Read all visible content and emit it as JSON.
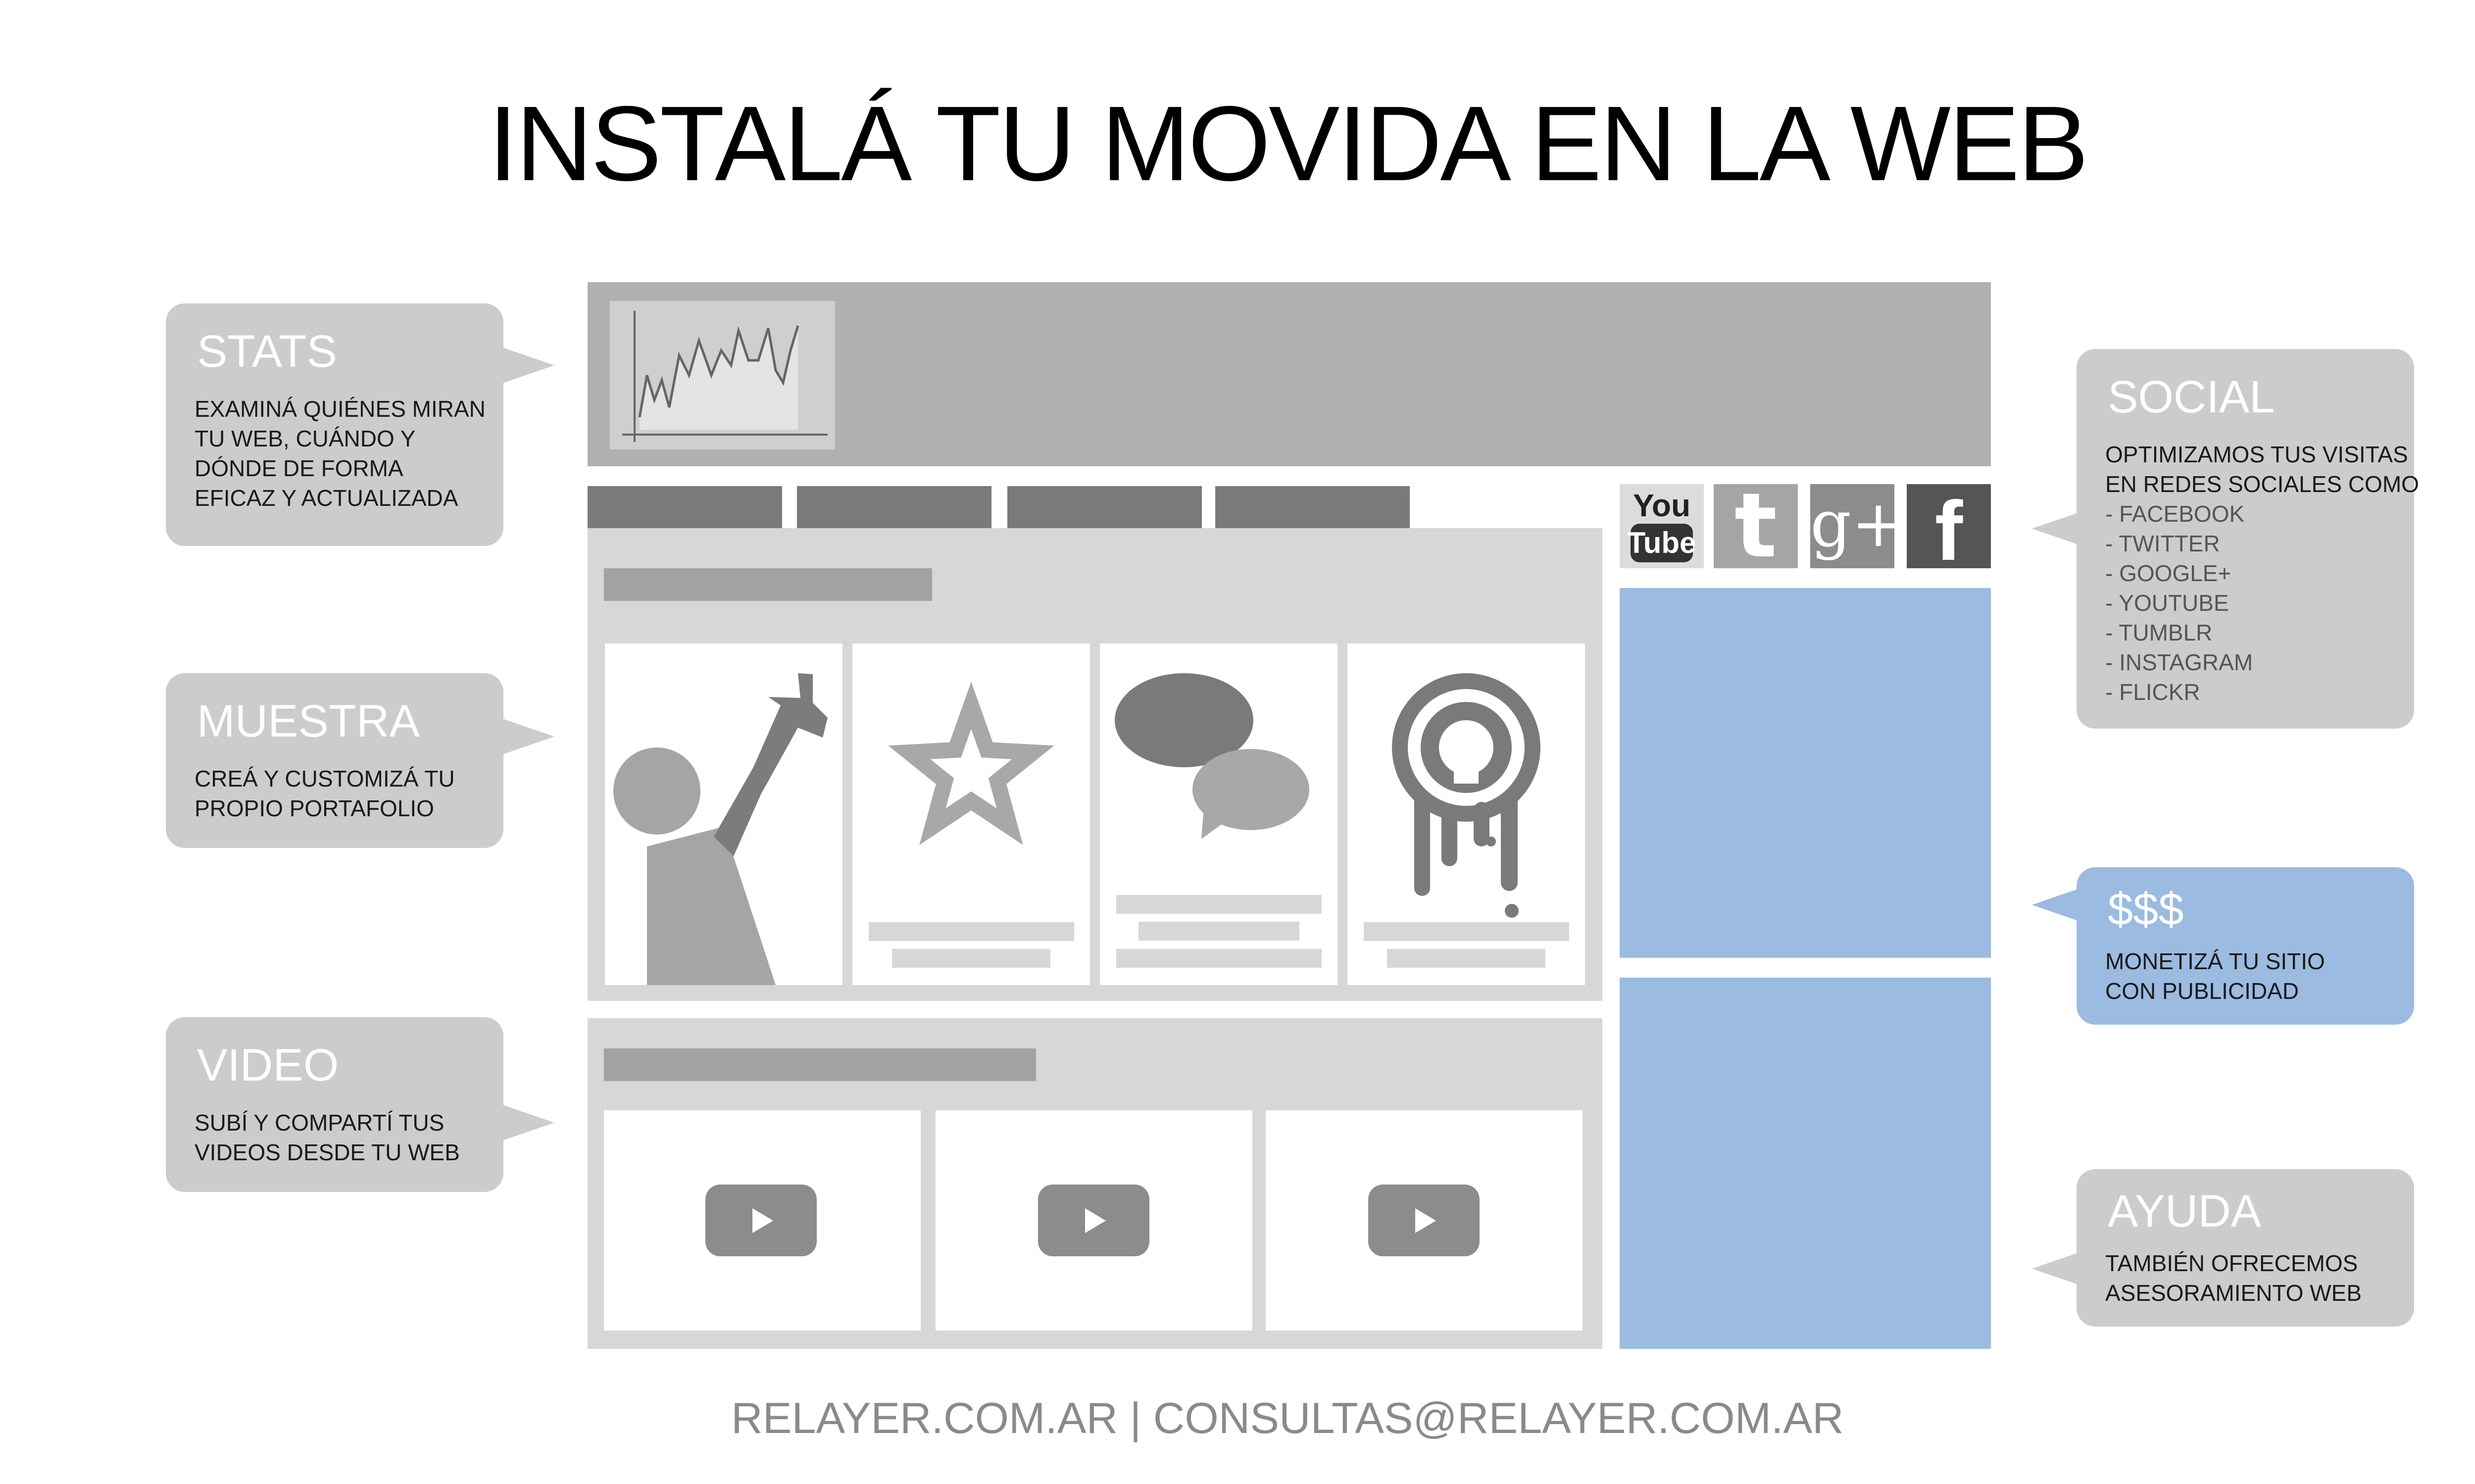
{
  "title": "INSTALÁ TU MOVIDA EN LA WEB",
  "footer": "RELAYER.COM.AR | CONSULTAS@RELAYER.COM.AR",
  "callouts": {
    "stats": {
      "title": "STATS",
      "lines": [
        "EXAMINÁ QUIÉNES MIRAN",
        "TU WEB, CUÁNDO Y",
        "DÓNDE DE FORMA",
        "EFICAZ Y ACTUALIZADA"
      ]
    },
    "muestra": {
      "title": "MUESTRA",
      "lines": [
        "CREÁ Y CUSTOMIZÁ TU",
        "PROPIO PORTAFOLIO"
      ]
    },
    "video": {
      "title": "VIDEO",
      "lines": [
        "SUBÍ Y COMPARTÍ TUS",
        "VIDEOS DESDE TU WEB"
      ]
    },
    "social": {
      "title": "SOCIAL",
      "lines": [
        "OPTIMIZAMOS TUS VISITAS",
        "EN REDES SOCIALES COMO",
        "- FACEBOOK",
        "- TWITTER",
        "- GOOGLE+",
        "- YOUTUBE",
        "- TUMBLR",
        "- INSTAGRAM",
        "- FLICKR"
      ]
    },
    "money": {
      "title": "$$$",
      "lines": [
        "MONETIZÁ TU SITIO",
        "CON PUBLICIDAD"
      ]
    },
    "ayuda": {
      "title": "AYUDA",
      "lines": [
        "TAMBIÉN OFRECEMOS",
        "ASESORAMIENTO WEB"
      ]
    }
  },
  "social_icons": {
    "youtube_top": "You",
    "youtube_bottom": "Tube",
    "twitter": "t",
    "googleplus": "g+",
    "facebook": "f"
  },
  "colors": {
    "bubble_gray": "#cccccc",
    "bubble_blue": "#9bbbe1",
    "panel_gray": "#d7d7d7",
    "header_gray": "#b0b0b0",
    "nav_gray": "#7a7a7a"
  }
}
